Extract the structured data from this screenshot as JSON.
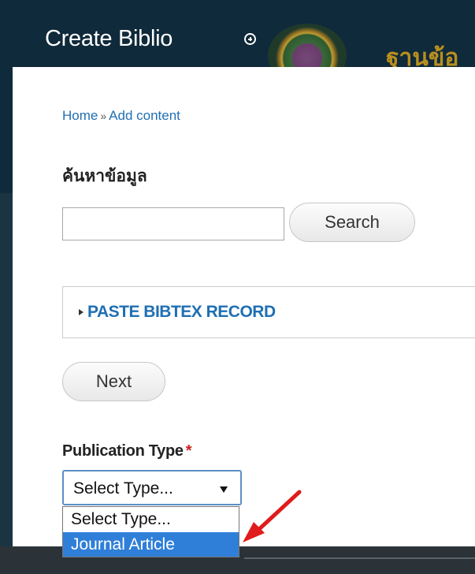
{
  "header": {
    "title": "Create Biblio",
    "add_icon": "circle-plus-icon",
    "brand_text": "ฐานข้อ"
  },
  "breadcrumb": {
    "home": "Home",
    "separator": "»",
    "current": "Add content"
  },
  "search_block": {
    "title": "ค้นหาข้อมูล",
    "input_value": "",
    "button_label": "Search"
  },
  "bibtex": {
    "legend": "PASTE BIBTEX RECORD"
  },
  "form": {
    "next_label": "Next",
    "publication_type_label": "Publication Type",
    "required_marker": "*",
    "selected_value": "Select Type...",
    "options": [
      "Select Type...",
      "Journal Article"
    ]
  },
  "colors": {
    "header_bg": "#0f2a3a",
    "link": "#1f6fb3",
    "required": "#cc2222",
    "option_highlight": "#2f7fd8",
    "annotation_arrow": "#e01b1b"
  }
}
